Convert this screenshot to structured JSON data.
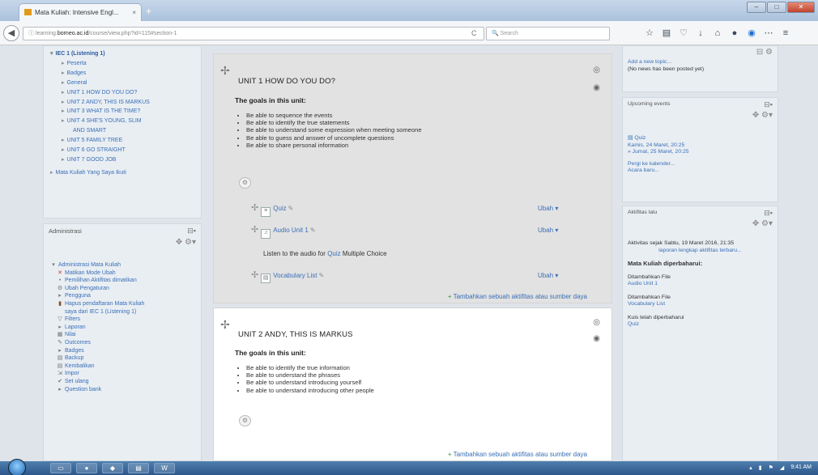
{
  "browser": {
    "tab_title": "Mata Kuliah: Intensive Engl...",
    "tab_close": "×",
    "new_tab": "+",
    "url_prefix": "learning.",
    "url_domain": "borneo.ac.id",
    "url_path": "/course/view.php?id=115#section-1",
    "search_placeholder": "Search",
    "reload": "C",
    "window_minimize": "–",
    "window_maximize": "□",
    "window_close": "✕"
  },
  "left_nav": {
    "course_label": "IEC 1 (Listening 1)",
    "items": [
      "Peserta",
      "Badges",
      "General",
      "UNIT 1 HOW DO YOU DO?",
      "UNIT 2 ANDY, THIS IS MARKUS",
      "UNIT 3 WHAT IS THE TIME?",
      "UNIT 4 SHE'S YOUNG, SLIM",
      "AND SMART",
      "UNIT 5 FAMILY TREE",
      "UNIT 6 GO STRAIGHT",
      "UNIT 7 GOOD JOB"
    ],
    "other_course": "Mata Kuliah Yang Saya Ikuti"
  },
  "admin": {
    "title": "Administrasi",
    "root": "Administrasi Mata Kuliah",
    "items": [
      "Matikan Mode Ubah",
      "Pemilihan Aktifitas dimatikan",
      "Ubah Pengaturan",
      "Pengguna",
      "Hapus pendaftaran Mata Kuliah",
      "saya dari IEC 1 (Listening 1)",
      "Filters",
      "Laporan",
      "Nilai",
      "Outcomes",
      "Badges",
      "Backup",
      "Kembalikan",
      "Impor",
      "Set ulang",
      "Question bank"
    ]
  },
  "unit1": {
    "title": "UNIT 1 HOW DO YOU DO?",
    "goals_heading": "The goals in this unit:",
    "goals": [
      "Be able to sequence the events",
      "Be able to identify the true statements",
      "Be able to understand some expression when meeting someone",
      "Be able to guess and answer of uncomplete questions",
      "Be able to share personal information"
    ],
    "activities": [
      {
        "name": "Quiz",
        "edit": "Ubah"
      },
      {
        "name": "Audio Unit 1",
        "edit": "Ubah"
      },
      {
        "name": "Vocabulary List",
        "edit": "Ubah"
      }
    ],
    "label_text_pre": "Listen to the audio for",
    "label_link": "Quiz",
    "label_text_post": "Multiple Choice",
    "add_activity": "Tambahkan sebuah aktifitas atau sumber daya"
  },
  "unit2": {
    "title": "UNIT 2 ANDY, THIS IS MARKUS",
    "goals_heading": "The goals in this unit:",
    "goals": [
      "Be able to identify the true information",
      "Be able to understand the phrases",
      "Be able to understand introducing yourself",
      "Be able to understand introducing other people"
    ],
    "add_activity": "Tambahkan sebuah aktifitas atau sumber daya"
  },
  "right": {
    "news_add": "Add a new topic...",
    "news_none": "(No news has been posted yet)",
    "upcoming_title": "Upcoming events",
    "event_name": "Quiz",
    "event_date1": "Kamis, 24 Maret, 20:25",
    "event_date2": "» Jumat, 25 Maret, 20:25",
    "goto_calendar": "Pergi ke kalender...",
    "new_event": "Acara baru...",
    "recent_title": "Aktifitas lalu",
    "since": "Aktivitas sejak Sabtu, 19 Maret 2016, 21:35",
    "full_report": "laporan lengkap aktifitas terbaru...",
    "updated_heading": "Mata Kuliah diperbaharui:",
    "updates": [
      {
        "type": "Ditambahkan File",
        "name": "Audio Unit 1"
      },
      {
        "type": "Ditambahkan File",
        "name": "Vocabulary List"
      },
      {
        "type": "Kuis telah diperbaharui",
        "name": "Quiz"
      }
    ]
  },
  "taskbar": {
    "time": "9:41 AM"
  }
}
